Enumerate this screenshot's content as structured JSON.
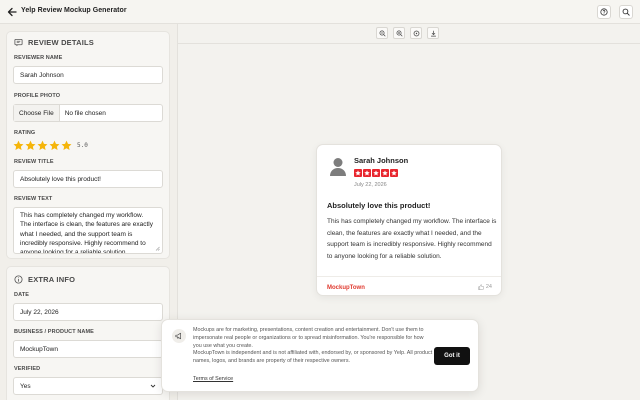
{
  "header": {
    "title": "Yelp Review Mockup Generator"
  },
  "sidebar": {
    "review_details": {
      "title": "REVIEW DETAILS",
      "reviewer_name_label": "REVIEWER NAME",
      "reviewer_name_value": "Sarah Johnson",
      "profile_photo_label": "PROFILE PHOTO",
      "choose_file_label": "Choose File",
      "no_file_text": "No file chosen",
      "rating_label": "RATING",
      "rating_value": "5.0",
      "rating_stars": 5,
      "review_title_label": "REVIEW TITLE",
      "review_title_value": "Absolutely love this product!",
      "review_text_label": "REVIEW TEXT",
      "review_text_value": "This has completely changed my workflow. The interface is clean, the features are exactly what I needed, and the support team is incredibly responsive. Highly recommend to anyone looking for a reliable solution."
    },
    "extra_info": {
      "title": "EXTRA INFO",
      "date_label": "DATE",
      "date_value": "July 22, 2026",
      "business_label": "BUSINESS / PRODUCT NAME",
      "business_value": "MockupTown",
      "verified_label": "VERIFIED",
      "verified_value": "Yes"
    }
  },
  "review_card": {
    "name": "Sarah Johnson",
    "date": "July 22, 2026",
    "title": "Absolutely love this product!",
    "text": "This has completely changed my workflow. The interface is clean, the features are exactly what I needed, and the support team is incredibly responsive. Highly recommend to anyone looking for a reliable solution.",
    "brand": "MockupTown",
    "likes": "24"
  },
  "disclaimer": {
    "line1": "Mockups are for marketing, presentations, content creation and entertainment. Don't use them to impersonate real people or organizations or to spread misinformation. You're responsible for how you use what you create.",
    "line2": "MockupTown is independent and is not affiliated with, endorsed by, or sponsored by Yelp. All product names, logos, and brands are property of their respective owners.",
    "terms_link": "Terms of Service",
    "button": "Got it"
  },
  "colors": {
    "star_gold": "#f5b50a",
    "star_red": "#e8262e",
    "brand_red": "#e03a2f",
    "button_dark": "#111111"
  },
  "icons": [
    "back-arrow-icon",
    "help-icon",
    "search-icon",
    "review-details-icon",
    "info-icon",
    "zoom-out-icon",
    "zoom-in-icon",
    "zoom-reset-icon",
    "download-icon",
    "avatar-icon",
    "thumbs-up-icon",
    "megaphone-icon",
    "chevron-down-icon"
  ]
}
